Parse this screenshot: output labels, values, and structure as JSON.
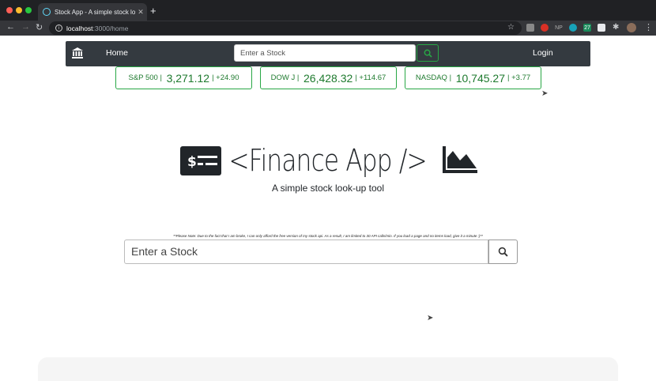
{
  "browser": {
    "tab_title": "Stock App - A simple stock lo",
    "tab_close": "✕",
    "new_tab": "+",
    "url_host": "localhost",
    "url_path": ":3000/home",
    "extensions": [
      "NP",
      "27"
    ]
  },
  "navbar": {
    "home_label": "Home",
    "search_placeholder": "Enter a Stock",
    "login_label": "Login"
  },
  "tickers": [
    {
      "name": "S&P 500",
      "value": "3,271.12",
      "change": "+24.90"
    },
    {
      "name": "DOW J",
      "value": "26,428.32",
      "change": "+114.67"
    },
    {
      "name": "NASDAQ",
      "value": "10,745.27",
      "change": "+3.77"
    }
  ],
  "hero": {
    "title": "<Finance App />",
    "subtitle": "A simple stock look-up tool"
  },
  "note": "**Please Note: Due to the fact that I am broke, I can only afford the free version of my stock api. As a result, I am limited to 30 API calls/min. If you load a page and no items load, give it a minute :)**",
  "search": {
    "placeholder": "Enter a Stock"
  },
  "colors": {
    "accent": "#28a745",
    "navbar_bg": "#343a40",
    "ticker_text": "#1e7a2e"
  }
}
